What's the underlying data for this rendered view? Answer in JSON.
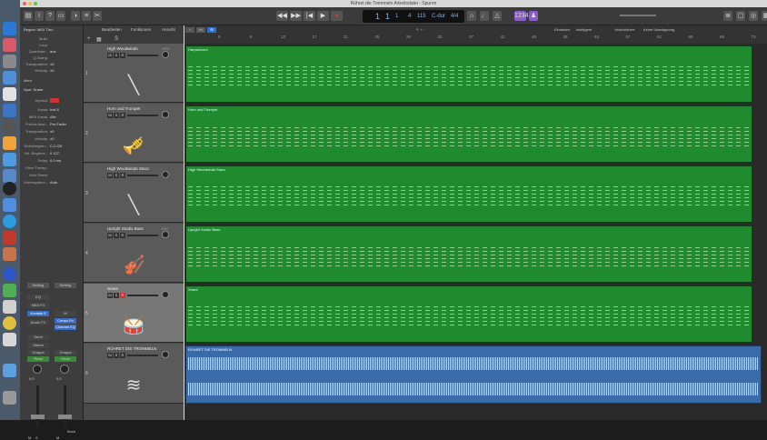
{
  "window": {
    "title": "Rühret die Trommeln Arbeitsdatei - Spuren"
  },
  "lcd": {
    "bar": "1",
    "beat": "1",
    "div": "1",
    "tempo": "4",
    "bpm": "115",
    "key": "C-dur",
    "sig": "4/4"
  },
  "cycle": "1234",
  "menus": {
    "edit": "Bearbeiten",
    "functions": "Funktionen",
    "view": "Ansicht",
    "snap_label": "Einrasten:",
    "snap_value": "Intelligent",
    "drag_label": "Verschieben:",
    "drag_value": "Keine Überlappung"
  },
  "inspector": {
    "region_header": "Region: MIDI Thru",
    "rows": [
      {
        "k": "Mute:",
        "v": ""
      },
      {
        "k": "Loop:",
        "v": ""
      },
      {
        "k": "Quantisier...",
        "v": "aus"
      },
      {
        "k": "Q-Swing:",
        "v": ""
      },
      {
        "k": "Transposition:",
        "v": "±0"
      },
      {
        "k": "Velocity:",
        "v": "±0"
      }
    ],
    "more": "Mehr",
    "track_header": "Spur: Snare",
    "symbol_label": "Symbol:",
    "track_rows": [
      {
        "k": "Kanal:",
        "v": "Inst 5"
      },
      {
        "k": "MIDI-Kanal:",
        "v": "Alle"
      },
      {
        "k": "Freeze-Mod...",
        "v": "Pre-Fader"
      },
      {
        "k": "Transposition:",
        "v": "±0"
      },
      {
        "k": "Velocity:",
        "v": "±0"
      },
      {
        "k": "Notenbegren...",
        "v": "C-2  G8"
      },
      {
        "k": "Vel.-Begrenz...",
        "v": "0  127"
      },
      {
        "k": "Delay:",
        "v": "0,0 ms"
      },
      {
        "k": "Ohne Transp.:",
        "v": ""
      },
      {
        "k": "Kein Reset:",
        "v": ""
      },
      {
        "k": "Notensystem...",
        "v": "Auto"
      }
    ],
    "strip": {
      "setting": "Setting",
      "eq": "EQ",
      "midi_fx": "MIDI FX",
      "instr1": "Kontakt 5",
      "instr2": "M",
      "audio_fx": "Audio FX",
      "fx2": "Compr Ex",
      "fx3": "Channel EQ",
      "send": "Send",
      "stereo": "Stereo",
      "group": "Gruppe",
      "read": "Read",
      "db1": "0,0",
      "db2": "0,0",
      "bounce": "Bnce",
      "name1": "Snare",
      "name2": "Stereo Out",
      "m": "M",
      "s": "S"
    }
  },
  "tracks": [
    {
      "num": "1",
      "name": "High Woodwinds",
      "sub": "HRD",
      "icon": "clarinet-icon",
      "region": "Harpsichord"
    },
    {
      "num": "2",
      "name": "Horn und Trumpet",
      "sub": "",
      "icon": "trumpet-icon",
      "region": "Horn und Trumpet"
    },
    {
      "num": "3",
      "name": "High Woodwinds Stacc",
      "sub": "",
      "icon": "clarinet-icon",
      "region": "High Woodwinds Stacc"
    },
    {
      "num": "4",
      "name": "Upright Studio Bass",
      "sub": "BSC",
      "icon": "double-bass-icon",
      "region": "Upright Studio Bass"
    },
    {
      "num": "5",
      "name": "Snare",
      "sub": "",
      "icon": "snare-drum-icon",
      "region": "Snare"
    },
    {
      "num": "6",
      "name": "RÜHRET DIE TROMMELN",
      "sub": "",
      "icon": "waveform-icon",
      "region": "RÜHRET DIE TROMMELN"
    }
  ],
  "ruler": [
    "5",
    "9",
    "13",
    "17",
    "21",
    "25",
    "29",
    "33",
    "37",
    "41",
    "45",
    "49",
    "53",
    "57",
    "61",
    "65",
    "69",
    "73"
  ],
  "toolbar": {
    "msr": "M",
    "s": "S",
    "r": "R"
  }
}
